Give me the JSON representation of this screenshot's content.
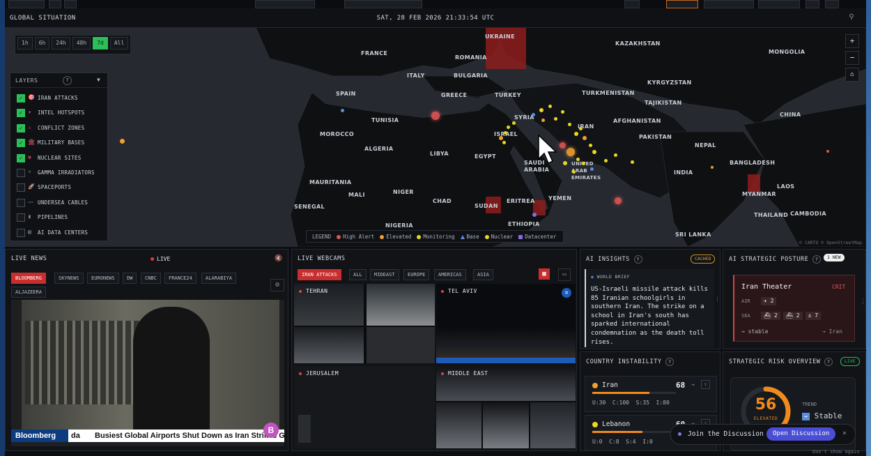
{
  "map": {
    "title": "GLOBAL SITUATION",
    "datetime": "SAT, 28 FEB 2026 21:33:54 UTC",
    "time_ranges": [
      "1h",
      "6h",
      "24h",
      "48h",
      "7d",
      "All"
    ],
    "active_range": "7d",
    "layers_title": "LAYERS",
    "layers": [
      {
        "label": "IRAN ATTACKS",
        "checked": true,
        "icon": "target-icon"
      },
      {
        "label": "INTEL HOTSPOTS",
        "checked": true,
        "icon": "hotspot-icon"
      },
      {
        "label": "CONFLICT ZONES",
        "checked": true,
        "icon": "crossed-swords-icon"
      },
      {
        "label": "MILITARY BASES",
        "checked": true,
        "icon": "base-icon"
      },
      {
        "label": "NUCLEAR SITES",
        "checked": true,
        "icon": "radiation-icon"
      },
      {
        "label": "GAMMA IRRADIATORS",
        "checked": false,
        "icon": "gamma-icon"
      },
      {
        "label": "SPACEPORTS",
        "checked": false,
        "icon": "rocket-icon"
      },
      {
        "label": "UNDERSEA CABLES",
        "checked": false,
        "icon": "cable-icon"
      },
      {
        "label": "PIPELINES",
        "checked": false,
        "icon": "pipeline-icon"
      },
      {
        "label": "AI DATA CENTERS",
        "checked": false,
        "icon": "server-icon"
      }
    ],
    "countries": [
      "UKRAINE",
      "KAZAKHSTAN",
      "MONGOLIA",
      "FRANCE",
      "ROMANIA",
      "ITALY",
      "BULGARIA",
      "KYRGYZSTAN",
      "SPAIN",
      "GREECE",
      "TURKEY",
      "TURKMENISTAN",
      "TAJIKISTAN",
      "CHINA",
      "TUNISIA",
      "SYRIA",
      "IRAN",
      "AFGHANISTAN",
      "MOROCCO",
      "ISRAEL",
      "PAKISTAN",
      "NEPAL",
      "ALGERIA",
      "LIBYA",
      "EGYPT",
      "SAUDI ARABIA",
      "UNITED ARAB EMIRATES",
      "BANGLADESH",
      "INDIA",
      "MAURITANIA",
      "MALI",
      "NIGER",
      "CHAD",
      "SUDAN",
      "ERITREA",
      "YEMEN",
      "MYANMAR",
      "LAOS",
      "THAILAND",
      "SENEGAL",
      "NIGERIA",
      "ETHIOPIA",
      "CAMBODIA",
      "SRI LANKA"
    ],
    "legend_title": "LEGEND",
    "legend": [
      {
        "label": "High Alert",
        "color": "#e05555"
      },
      {
        "label": "Elevated",
        "color": "#f0a030"
      },
      {
        "label": "Monitoring",
        "color": "#e8d820"
      },
      {
        "label": "Base",
        "color": "#5a8fe0"
      },
      {
        "label": "Nuclear",
        "color": "#e8d820"
      },
      {
        "label": "Datacenter",
        "color": "#8a6ae0"
      }
    ],
    "attribution": "© CARTO © OpenStreetMap"
  },
  "live_news": {
    "title": "LIVE NEWS",
    "live_label": "LIVE",
    "channels": [
      "BLOOMBERG",
      "SKYNEWS",
      "EURONEWS",
      "DW",
      "CNBC",
      "FRANCE24",
      "ALARABIYA",
      "ALJAZEERA"
    ],
    "active_channel": "BLOOMBERG",
    "ticker_brand": "Bloomberg",
    "ticker_tag": "da",
    "ticker_text": "Busiest Global Airports Shut Down as Iran Strikes Gu"
  },
  "webcams": {
    "title": "LIVE WEBCAMS",
    "filters": [
      "IRAN ATTACKS",
      "ALL",
      "MIDEAST",
      "EUROPE",
      "AMERICAS",
      "ASIA"
    ],
    "active_filter": "IRAN ATTACKS",
    "cams": [
      "TEHRAN",
      "TEL AVIV",
      "JERUSALEM",
      "MIDDLE EAST"
    ]
  },
  "ai_insights": {
    "title": "AI INSIGHTS",
    "badge": "CACHED",
    "section": "WORLD BRIEF",
    "text": "US-Israeli missile attack kills 85 Iranian schoolgirls in southern Iran. The strike on a school in Iran's south has sparked international condemnation as the death toll rises."
  },
  "posture": {
    "title": "AI STRATEGIC POSTURE",
    "badge": "1 NEW",
    "theater": "Iran Theater",
    "level": "CRIT",
    "air_label": "AIR",
    "air_value": "2",
    "sea_label": "SEA",
    "sea_values": [
      "2",
      "2",
      "7"
    ],
    "trend": "stable",
    "target": "Iran"
  },
  "instability": {
    "title": "COUNTRY INSTABILITY",
    "rows": [
      {
        "country": "Iran",
        "score": "68",
        "stats": "U:30  C:100  S:35  I:80",
        "bar": 0.68
      },
      {
        "country": "Lebanon",
        "score": "60",
        "stats": "U:0  C:8  S:4  I:0",
        "bar": 0.6
      }
    ]
  },
  "risk": {
    "title": "STRATEGIC RISK OVERVIEW",
    "badge": "LIVE",
    "score": "56",
    "score_label": "ELEVATED",
    "trend_label": "TREND",
    "trend_value": "Stable"
  },
  "discussion": {
    "text": "Join the Discussion",
    "button": "Open Discussion",
    "dont_show": "Don't show again"
  }
}
